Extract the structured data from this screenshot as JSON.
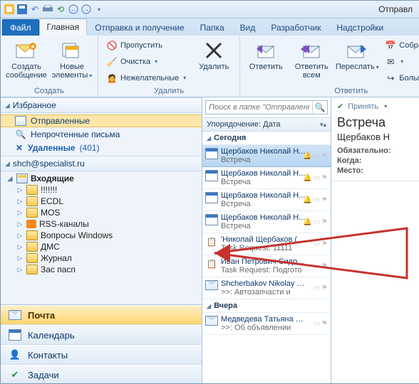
{
  "window": {
    "title": "Отправл"
  },
  "tabs": {
    "file": "Файл",
    "items": [
      {
        "label": "Главная"
      },
      {
        "label": "Отправка и получение"
      },
      {
        "label": "Папка"
      },
      {
        "label": "Вид"
      },
      {
        "label": "Разработчик"
      },
      {
        "label": "Надстройки"
      }
    ]
  },
  "ribbon": {
    "group_create": {
      "caption": "Создать",
      "new_msg": "Создать сообщение",
      "new_items": "Новые элементы"
    },
    "group_delete": {
      "caption": "Удалить",
      "ignore": "Пропустить",
      "cleanup": "Очистка",
      "junk": "Нежелательные",
      "delete": "Удалить"
    },
    "group_respond": {
      "caption": "Ответить",
      "reply": "Ответить",
      "replyall": "Ответить всем",
      "forward": "Переслать",
      "meeting": "Собрание",
      "more": "Больше"
    }
  },
  "nav": {
    "favorites_hdr": "Избранное",
    "favorites": [
      {
        "label": "Отправленные"
      },
      {
        "label": "Непрочтенные письма"
      },
      {
        "label": "Удаленные",
        "count": "(401)"
      }
    ],
    "account": "shch@specialist.ru",
    "inbox": "Входящие",
    "folders": [
      {
        "label": "!!!!!!!"
      },
      {
        "label": "ECDL"
      },
      {
        "label": "MOS"
      },
      {
        "label": "RSS-каналы",
        "rss": true
      },
      {
        "label": "Вопросы Windows"
      },
      {
        "label": "ДМС"
      },
      {
        "label": "Журнал"
      },
      {
        "label": "Зас пасп"
      }
    ],
    "buttons": {
      "mail": "Почта",
      "calendar": "Календарь",
      "contacts": "Контакты",
      "tasks": "Задачи"
    }
  },
  "list": {
    "search_placeholder": "Поиск в папке \"Отправленные\" (CTF",
    "arrange_label": "Упорядочение:",
    "arrange_value": "Дата",
    "groups": [
      {
        "title": "Сегодня",
        "items": [
          {
            "from": "Щербаков Николай Н...",
            "subj": "Встреча",
            "bell": true,
            "sel": true,
            "icon": "cal"
          },
          {
            "from": "Щербаков Николай Н...",
            "subj": "Встреча",
            "bell": true,
            "icon": "cal"
          },
          {
            "from": "Щербаков Николай Н...",
            "subj": "Встреча",
            "bell": true,
            "icon": "cal"
          },
          {
            "from": "Щербаков Николай Н...",
            "subj": "Встреча",
            "bell": true,
            "icon": "cal"
          },
          {
            "from": "'Николай Щербаков (...",
            "subj": "Task Request: 11111",
            "icon": "task"
          },
          {
            "from": "Иван Петрович Сидо...",
            "subj": "Task Request: Подгото",
            "icon": "task"
          },
          {
            "from": "Shcherbakov Nikolay 1...",
            "subj": ">>: Автозапчасти и",
            "icon": "env"
          }
        ]
      },
      {
        "title": "Вчера",
        "items": [
          {
            "from": "Медведева Татьяна Н...",
            "subj": ">>: Об объявлении",
            "icon": "env"
          }
        ]
      }
    ]
  },
  "reading": {
    "accept": "Принять",
    "title": "Встреча",
    "organizer": "Щербаков Н",
    "required_lbl": "Обязательно:",
    "when_lbl": "Когда:",
    "where_lbl": "Место:"
  }
}
